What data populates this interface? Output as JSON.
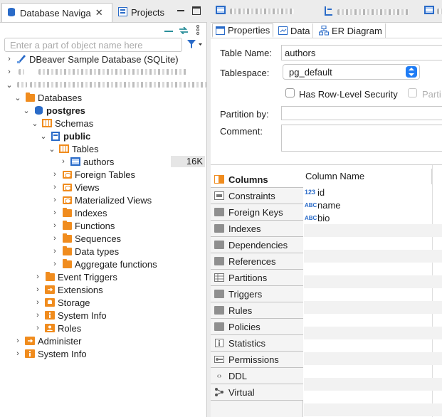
{
  "navigator": {
    "tab_db": "Database Naviga",
    "tab_projects": "Projects",
    "filter_placeholder": "Enter a part of object name here",
    "tree": {
      "sample_db": "DBeaver Sample Database (SQLite)",
      "databases": "Databases",
      "postgres": "postgres",
      "schemas": "Schemas",
      "public": "public",
      "tables": "Tables",
      "authors": "authors",
      "authors_size": "16K",
      "foreign_tables": "Foreign Tables",
      "views": "Views",
      "materialized_views": "Materialized Views",
      "indexes": "Indexes",
      "functions": "Functions",
      "sequences": "Sequences",
      "data_types": "Data types",
      "aggregate_functions": "Aggregate functions",
      "event_triggers": "Event Triggers",
      "extensions": "Extensions",
      "storage": "Storage",
      "system_info_db": "System Info",
      "roles": "Roles",
      "administer": "Administer",
      "system_info": "System Info"
    }
  },
  "editor": {
    "subtabs": {
      "properties": "Properties",
      "data": "Data",
      "er": "ER Diagram"
    },
    "form": {
      "table_name_label": "Table Name:",
      "table_name_value": "authors",
      "tablespace_label": "Tablespace:",
      "tablespace_value": "pg_default",
      "row_level_security": "Has Row-Level Security",
      "partition_cut": "Parti",
      "partition_by_label": "Partition by:",
      "comment_label": "Comment:"
    },
    "sections": {
      "columns": "Columns",
      "constraints": "Constraints",
      "foreign_keys": "Foreign Keys",
      "indexes": "Indexes",
      "dependencies": "Dependencies",
      "references": "References",
      "partitions": "Partitions",
      "triggers": "Triggers",
      "rules": "Rules",
      "policies": "Policies",
      "statistics": "Statistics",
      "permissions": "Permissions",
      "ddl": "DDL",
      "virtual": "Virtual"
    },
    "grid": {
      "header": "Column Name",
      "type_num": "123",
      "type_abc": "ABC",
      "col_id": "id",
      "col_name": "name",
      "col_bio": "bio"
    }
  },
  "colors": {
    "accent_blue": "#2a6bc8",
    "folder_orange": "#f08c1e",
    "select_blue": "#1f7cf5"
  }
}
